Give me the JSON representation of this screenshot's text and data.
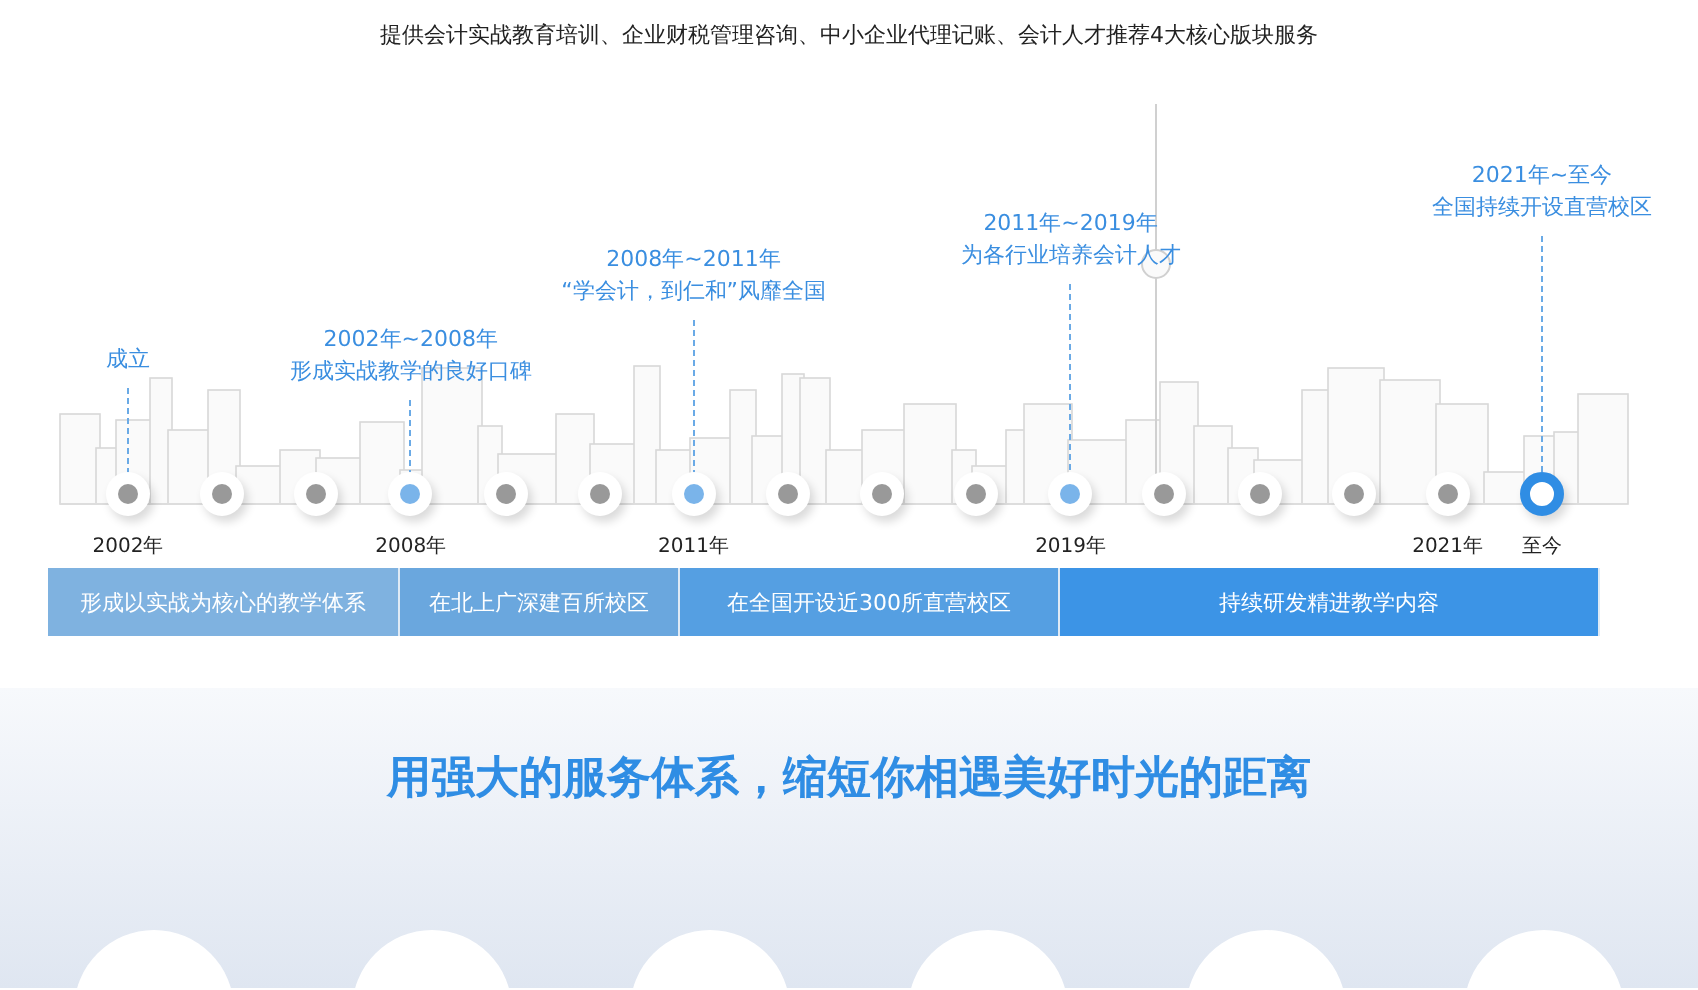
{
  "intro": "提供会计实战教育培训、企业财税管理咨询、中小企业代理记账、会计人才推荐4大核心版块服务",
  "timeline": [
    {
      "kind": "past",
      "year": "2002年",
      "callout": [
        "成立"
      ]
    },
    {
      "kind": "past"
    },
    {
      "kind": "past"
    },
    {
      "kind": "milestone",
      "year": "2008年",
      "callout": [
        "2002年~2008年",
        "形成实战教学的良好口碑"
      ]
    },
    {
      "kind": "past"
    },
    {
      "kind": "past"
    },
    {
      "kind": "milestone",
      "year": "2011年",
      "callout": [
        "2008年~2011年",
        "“学会计，到仁和”风靡全国"
      ]
    },
    {
      "kind": "past"
    },
    {
      "kind": "past"
    },
    {
      "kind": "past"
    },
    {
      "kind": "milestone",
      "year": "2019年",
      "callout": [
        "2011年~2019年",
        "为各行业培养会计人才"
      ]
    },
    {
      "kind": "past"
    },
    {
      "kind": "past"
    },
    {
      "kind": "past"
    },
    {
      "kind": "past",
      "year": "2021年"
    },
    {
      "kind": "current",
      "year": "至今",
      "callout": [
        "2021年~至今",
        "全国持续开设直营校区"
      ]
    }
  ],
  "stages": [
    {
      "label": "形成以实战为核心的教学体系",
      "color": "#7fb2e0"
    },
    {
      "label": "在北上广深建百所校区",
      "color": "#6aa7de"
    },
    {
      "label": "在全国开设近300所直营校区",
      "color": "#559fe2"
    },
    {
      "label": "持续研发精进教学内容",
      "color": "#3c94e6"
    }
  ],
  "section_title": "用强大的服务体系，缩短你相遇美好时光的距离"
}
